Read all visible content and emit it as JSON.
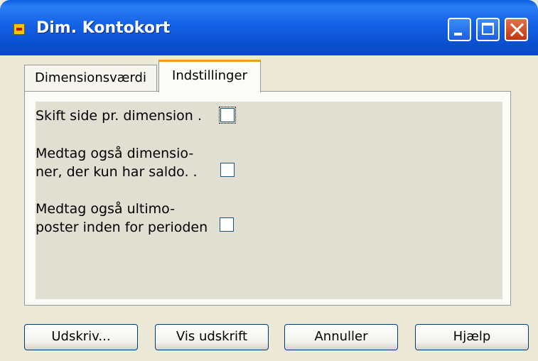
{
  "window": {
    "title": "Dim. Kontokort",
    "icon": "app-icon",
    "controls": [
      "minimize-icon",
      "maximize-icon",
      "close-icon"
    ]
  },
  "tabs": [
    {
      "label": "Dimensionsværdi",
      "active": false
    },
    {
      "label": "Indstillinger",
      "active": true
    }
  ],
  "options": [
    {
      "lines": [
        "Skift side pr. dimension  ."
      ],
      "checked": false
    },
    {
      "lines": [
        "Medtag også dimensio-",
        "ner, der kun har saldo.   ."
      ],
      "checked": false
    },
    {
      "lines": [
        "Medtag også ultimo-",
        "poster inden for perioden"
      ],
      "checked": false
    }
  ],
  "buttons": {
    "print": "Udskriv...",
    "preview": "Vis udskrift",
    "cancel": "Annuller",
    "help": "Hjælp"
  }
}
